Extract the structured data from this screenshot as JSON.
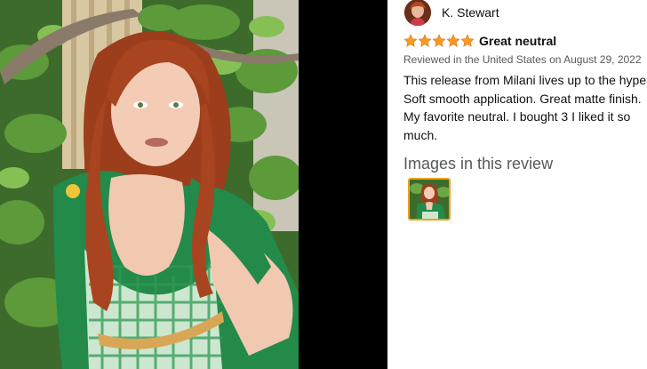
{
  "review": {
    "reviewer_name": "K. Stewart",
    "rating": 5,
    "rating_max": 5,
    "title": "Great neutral",
    "meta": "Reviewed in the United States on August 29, 2022",
    "body": "This release from Milani lives up to the hype. Soft smooth application. Great matte finish. My favorite neutral. I bought 3 I liked it so much.",
    "images_heading": "Images in this review"
  },
  "colors": {
    "star": "#f79a1f",
    "thumb_border": "#f0a020",
    "meta_text": "#565959"
  },
  "icons": {
    "star": "star-icon"
  }
}
